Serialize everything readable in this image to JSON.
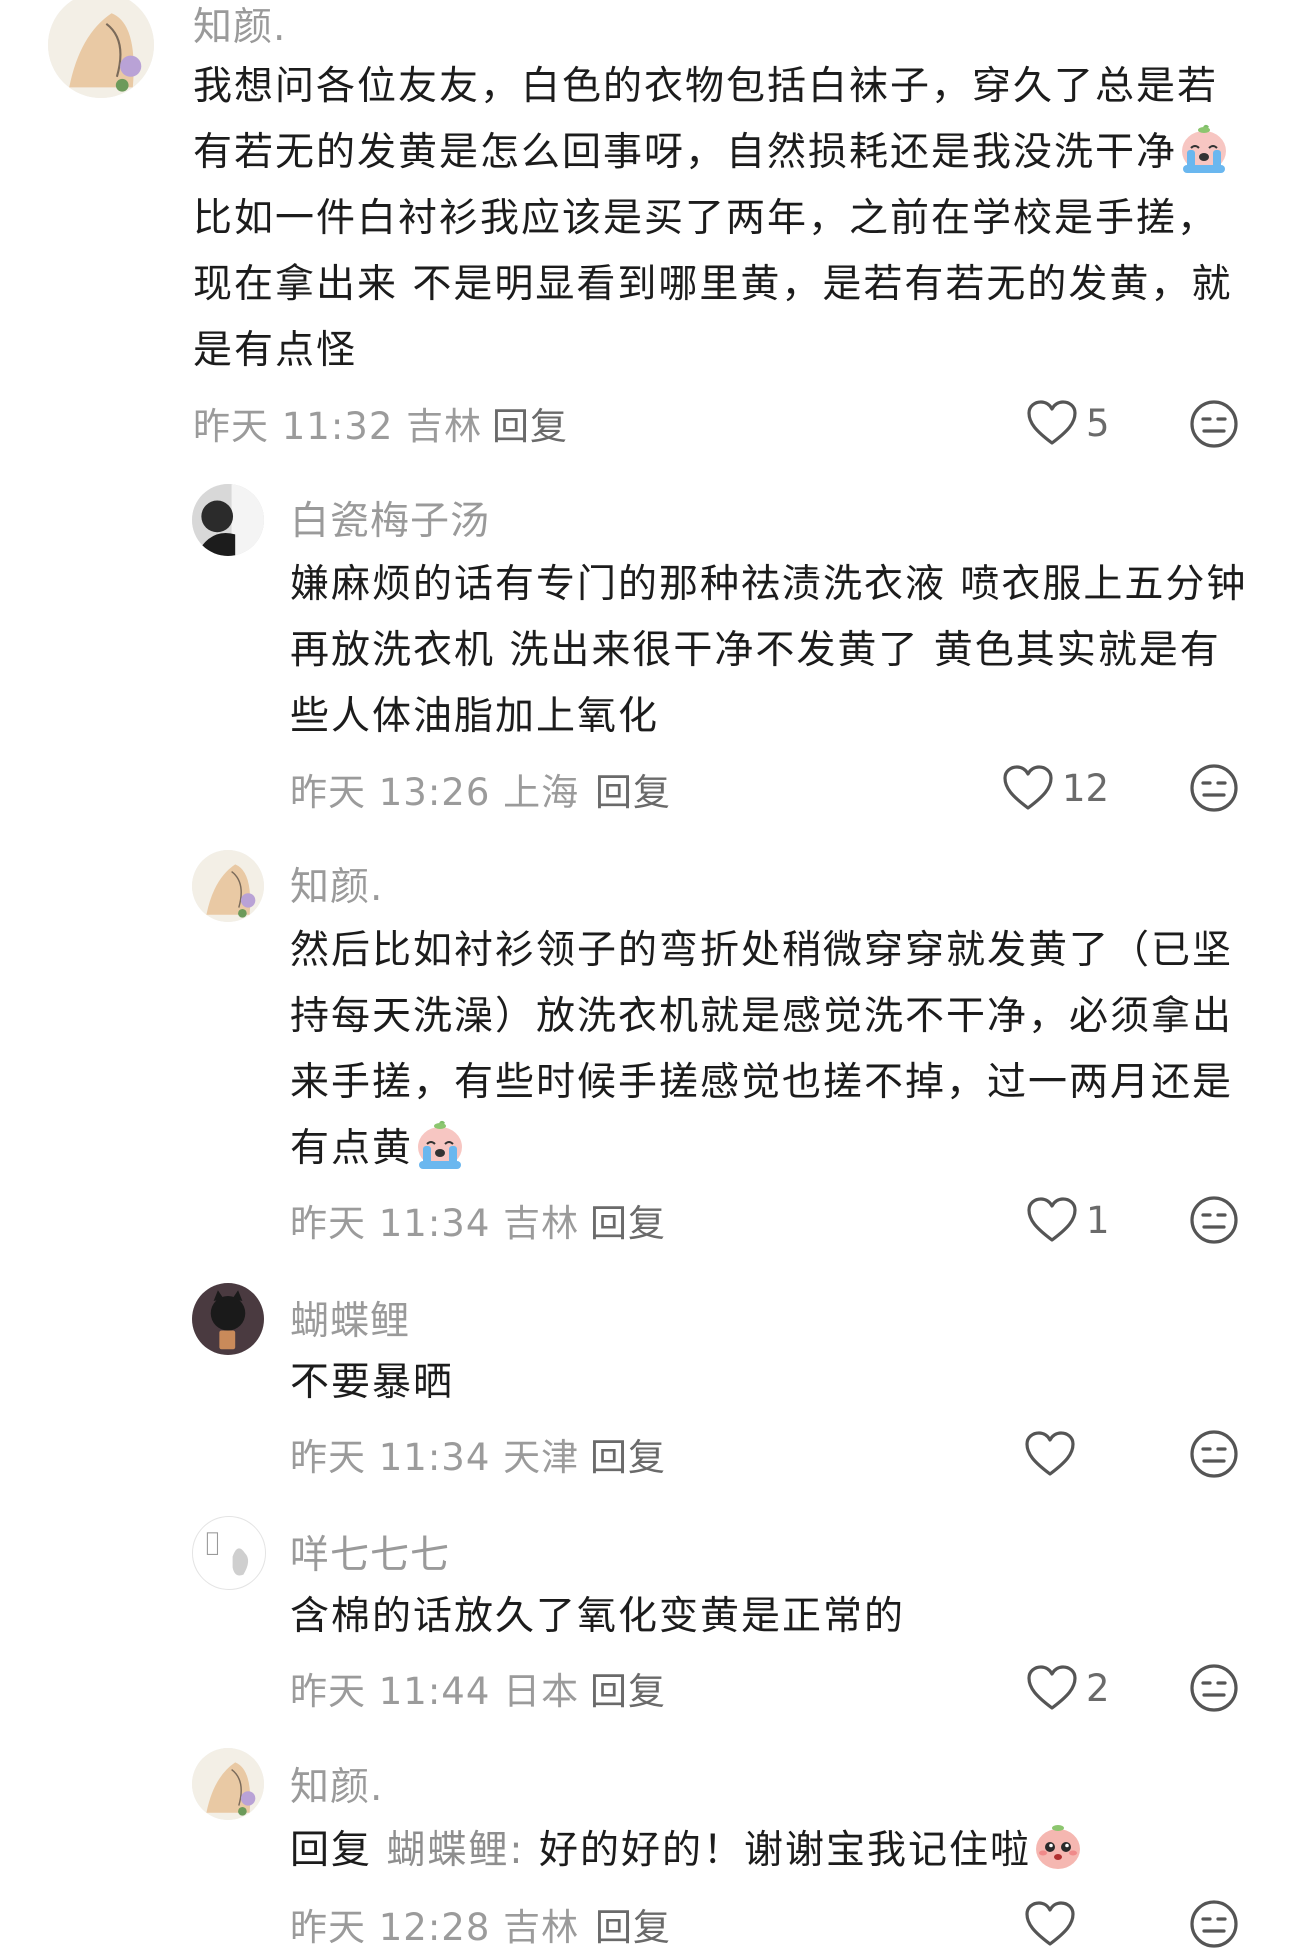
{
  "comments": [
    {
      "username": "知颜.",
      "text_before_emoji": "我想问各位友友，白色的衣物包括白袜子，穿久了总是若有若无的发黄是怎么回事呀，自然损耗还是我没洗干净",
      "emoji": "crying-peach-emoji",
      "text_after_emoji": "比如一件白衬衫我应该是买了两年，之前在学校是手搓，现在拿出来 不是明显看到哪里黄，是若有若无的发黄，就是有点怪",
      "time": "昨天 11:32",
      "location": "吉林",
      "reply_label": "回复",
      "likes": "5"
    },
    {
      "username": "白瓷梅子汤",
      "text": "嫌麻烦的话有专门的那种祛渍洗衣液 喷衣服上五分钟再放洗衣机 洗出来很干净不发黄了 黄色其实就是有些人体油脂加上氧化",
      "time": "昨天 13:26",
      "location": "上海",
      "reply_label": "回复",
      "likes": "12"
    },
    {
      "username": "知颜.",
      "text": "然后比如衬衫领子的弯折处稍微穿穿就发黄了（已坚持每天洗澡）放洗衣机就是感觉洗不干净，必须拿出来手搓，有些时候手搓感觉也搓不掉，过一两月还是有点黄",
      "emoji": "crying-peach-emoji",
      "time": "昨天 11:34",
      "location": "吉林",
      "reply_label": "回复",
      "likes": "1"
    },
    {
      "username": "蝴蝶鲤",
      "text": "不要暴晒",
      "time": "昨天 11:34",
      "location": "天津",
      "reply_label": "回复",
      "likes": ""
    },
    {
      "username": "咩七七七",
      "text": "含棉的话放久了氧化变黄是正常的",
      "time": "昨天 11:44",
      "location": "日本",
      "reply_label": "回复",
      "likes": "2"
    },
    {
      "username": "知颜.",
      "reply_prefix": "回复",
      "reply_to": "蝴蝶鲤:",
      "text": "好的好的！谢谢宝我记住啦",
      "emoji": "pleading-peach-emoji",
      "time": "昨天 12:28",
      "location": "吉林",
      "reply_label": "回复",
      "likes": ""
    }
  ],
  "colors": {
    "username": "#9a9a9a",
    "body_text": "#1c1c1c",
    "meta": "#9b9b9b",
    "icon_stroke": "#555555"
  }
}
